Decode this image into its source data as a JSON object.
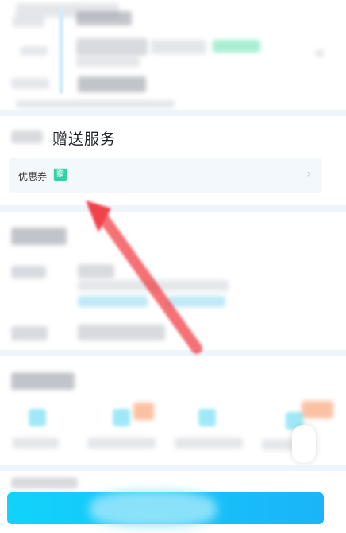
{
  "gift_service": {
    "title": "赠送服务",
    "coupon_label": "优惠券",
    "coupon_badge": "赠",
    "chevron": "›"
  },
  "colors": {
    "accent": "#1ab4f7",
    "badge": "#2fd3a7",
    "annotation_arrow": "#f0202a",
    "divider": "#eef4fb"
  },
  "icons": [
    "chevron-right-icon",
    "annotation-arrow"
  ]
}
